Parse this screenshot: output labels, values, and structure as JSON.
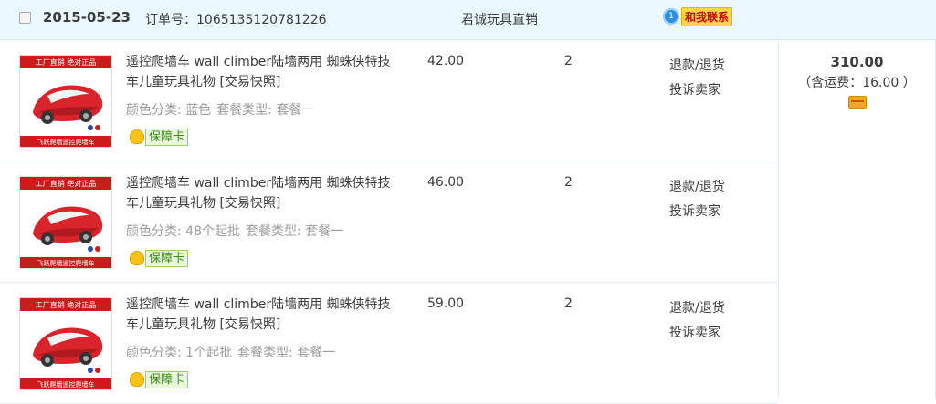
{
  "order": {
    "date": "2015-05-23",
    "order_no": "订单号：1065135120781226",
    "shop": "君诚玩具直销",
    "contact_label": "和我联系",
    "contact_icon_text": "1"
  },
  "items": [
    {
      "title": "遥控爬墙车 wall climber陆墙两用 蜘蛛侠特技车儿童玩具礼物 [交易快照]",
      "spec_color": "颜色分类: 蓝色",
      "spec_type": "套餐类型: 套餐一",
      "badge": "保障卡",
      "price": "42.00",
      "qty": "2",
      "op_refund": "退款/退货",
      "op_complain": "投诉卖家"
    },
    {
      "title": "遥控爬墙车 wall climber陆墙两用 蜘蛛侠特技车儿童玩具礼物 [交易快照]",
      "spec_color": "颜色分类: 48个起批",
      "spec_type": "套餐类型: 套餐一",
      "badge": "保障卡",
      "price": "46.00",
      "qty": "2",
      "op_refund": "退款/退货",
      "op_complain": "投诉卖家"
    },
    {
      "title": "遥控爬墙车 wall climber陆墙两用 蜘蛛侠特技车儿童玩具礼物 [交易快照]",
      "spec_color": "颜色分类: 1个起批",
      "spec_type": "套餐类型: 套餐一",
      "badge": "保障卡",
      "price": "59.00",
      "qty": "2",
      "op_refund": "退款/退货",
      "op_complain": "投诉卖家"
    }
  ],
  "thumb": {
    "top_text": "工厂直销 绝对正品",
    "bottom_text": "飞跃爬墙遥控爬墙车"
  },
  "total": {
    "amount": "310.00",
    "shipping": "（含运费：16.00 ）"
  },
  "colors": {
    "header_bg": "#eaf8ff",
    "accent_red": "#cc1b1b",
    "spec_gray": "#9c9c9c"
  },
  "icons": [
    "checkbox",
    "contact-icon",
    "badge-leaf-icon",
    "payment-card-icon"
  ]
}
